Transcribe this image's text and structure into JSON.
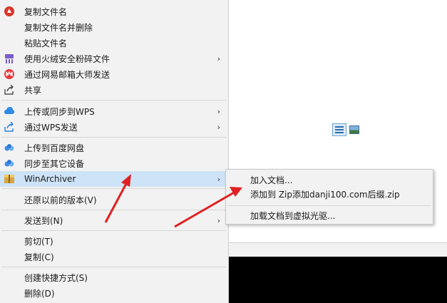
{
  "context_menu": {
    "items": [
      {
        "label": "复制文件名",
        "icon": "red-app-icon"
      },
      {
        "label": "复制文件名并删除",
        "icon": ""
      },
      {
        "label": "粘贴文件名",
        "icon": ""
      },
      {
        "label": "使用火绒安全粉碎文件",
        "icon": "shredder-icon"
      },
      {
        "label": "通过网易邮箱大师发送",
        "icon": "mail-master-icon"
      },
      {
        "label": "共享",
        "icon": "share-icon"
      },
      {
        "label": "上传或同步到WPS",
        "icon": "cloud-icon"
      },
      {
        "label": "通过WPS发送",
        "icon": "send-icon"
      },
      {
        "label": "上传到百度网盘",
        "icon": "baidu-cloud-icon"
      },
      {
        "label": "同步至其它设备",
        "icon": "baidu-sync-icon"
      },
      {
        "label": "WinArchiver",
        "icon": "archive-icon"
      },
      {
        "label": "还原以前的版本(V)",
        "icon": ""
      },
      {
        "label": "发送到(N)",
        "icon": ""
      },
      {
        "label": "剪切(T)",
        "icon": ""
      },
      {
        "label": "复制(C)",
        "icon": ""
      },
      {
        "label": "创建快捷方式(S)",
        "icon": ""
      },
      {
        "label": "删除(D)",
        "icon": ""
      }
    ]
  },
  "submenu": {
    "items": [
      {
        "label": "加入文档..."
      },
      {
        "label": "添加到 Zip添加danji100.com后缀.zip"
      },
      {
        "label": "加载文档到虚拟光驱..."
      }
    ]
  },
  "colors": {
    "menu_bg": "#f2f2f2",
    "highlight": "#cde3f7",
    "annotation_arrow": "#e02020"
  }
}
